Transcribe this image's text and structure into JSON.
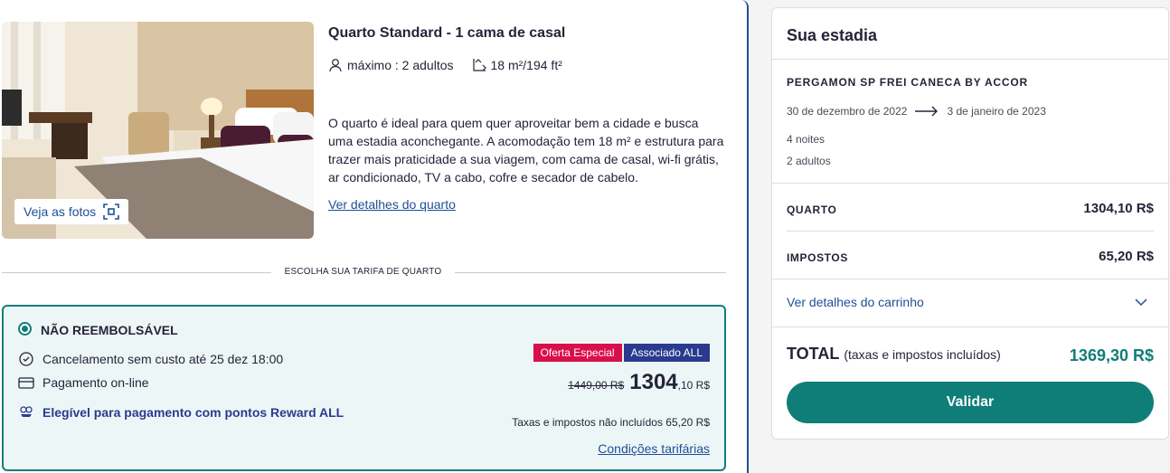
{
  "room": {
    "title": "Quarto Standard - 1 cama de casal",
    "capacity": "máximo : 2 adultos",
    "area": "18 m²/194 ft²",
    "description": "O quarto é ideal para quem quer aproveitar bem a cidade e busca uma estadia aconchegante. A acomodação tem 18 m² e estrutura para trazer mais praticidade a sua viagem, com cama de casal, wi-fi grátis, ar condicionado, TV a cabo, cofre e secador de cabelo.",
    "details_link": "Ver detalhes do quarto",
    "photos_button": "Veja as fotos"
  },
  "divider_label": "ESCOLHA SUA TARIFA DE QUARTO",
  "rate": {
    "title": "NÃO REEMBOLSÁVEL",
    "cancellation": "Cancelamento sem custo até 25 dez 18:00",
    "payment": "Pagamento on-line",
    "reward": "Elegível para pagamento com pontos Reward ALL",
    "badges": [
      "Oferta Especial",
      "Associado ALL"
    ],
    "old_price": "1449,00 R$",
    "price_main": "1304",
    "price_cents": ",10 R$",
    "tax_note": "Taxas e impostos não incluídos 65,20 R$",
    "conditions_link": "Condições tarifárias",
    "selected": true
  },
  "summary": {
    "title": "Sua estadia",
    "hotel": "PERGAMON SP FREI CANECA BY ACCOR",
    "checkin": "30 de dezembro de 2022",
    "checkout": "3 de janeiro de 2023",
    "nights": "4 noites",
    "guests": "2 adultos",
    "room_label": "QUARTO",
    "room_value": "1304,10 R$",
    "tax_label": "IMPOSTOS",
    "tax_value": "65,20 R$",
    "cart_link": "Ver detalhes do carrinho",
    "total_label": "TOTAL",
    "total_sub": "(taxas e impostos incluídos)",
    "total_value": "1369,30 R$",
    "validate_button": "Validar"
  },
  "colors": {
    "accent_teal": "#0f7d78",
    "link_blue": "#1f4e96",
    "badge_pink": "#d80f4b",
    "badge_navy": "#2a3b8f",
    "rate_bg": "#edf6f6"
  },
  "icons": [
    "person-icon",
    "area-icon",
    "expand-photos-icon",
    "clock-icon",
    "card-icon",
    "reward-icon",
    "arrow-right-icon",
    "chevron-down-icon"
  ]
}
